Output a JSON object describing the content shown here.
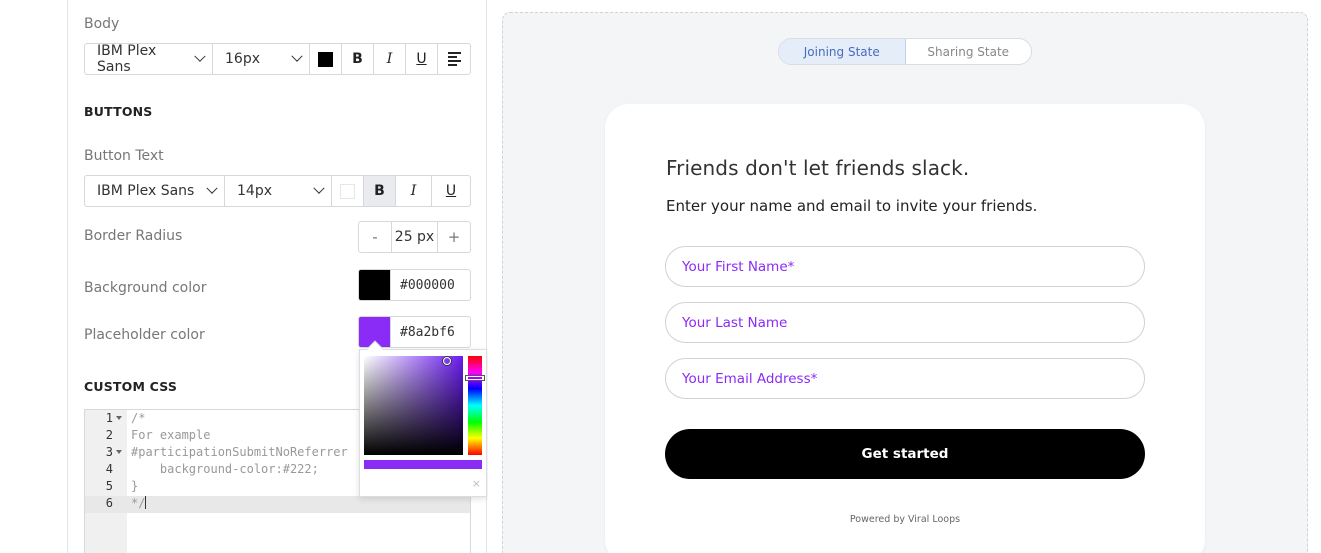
{
  "typography": {
    "body": {
      "label": "Body",
      "font": "IBM Plex Sans",
      "size": "16px",
      "color": "#000000",
      "bold_label": "B",
      "italic_label": "I",
      "underline_label": "U",
      "align_icon": "align-left-icon"
    },
    "buttons_title": "BUTTONS",
    "button_text": {
      "label": "Button Text",
      "font": "IBM Plex Sans",
      "size": "14px",
      "bold_label": "B",
      "italic_label": "I",
      "underline_label": "U"
    },
    "border_radius": {
      "label": "Border Radius",
      "decrement": "-",
      "value": "25 px",
      "increment": "+"
    },
    "background_color": {
      "label": "Background color",
      "swatch": "#000000",
      "value": "#000000"
    },
    "placeholder_color": {
      "label": "Placeholder color",
      "swatch": "#8a2bf6",
      "value": "#8a2bf6"
    }
  },
  "color_picker": {
    "hue_color": "#6a1cf0",
    "preview_color": "#8a2bf6",
    "close_label": "×"
  },
  "custom_css": {
    "title": "CUSTOM CSS",
    "lines": [
      {
        "number": "1",
        "code": "/*"
      },
      {
        "number": "2",
        "code": "For example"
      },
      {
        "number": "3",
        "code": "#participationSubmitNoReferrer"
      },
      {
        "number": "4",
        "code": "    background-color:#222;"
      },
      {
        "number": "5",
        "code": "}"
      },
      {
        "number": "6",
        "code": "*/"
      }
    ]
  },
  "preview": {
    "states": [
      "Joining State",
      "Sharing State"
    ],
    "active_state": "Joining State",
    "title": "Friends don't let friends slack.",
    "subtitle": "Enter your name and email to invite your friends.",
    "fields": [
      {
        "placeholder": "Your First Name*"
      },
      {
        "placeholder": "Your Last Name"
      },
      {
        "placeholder": "Your Email Address*"
      }
    ],
    "button_label": "Get started",
    "powered_by": "Powered by Viral Loops"
  }
}
